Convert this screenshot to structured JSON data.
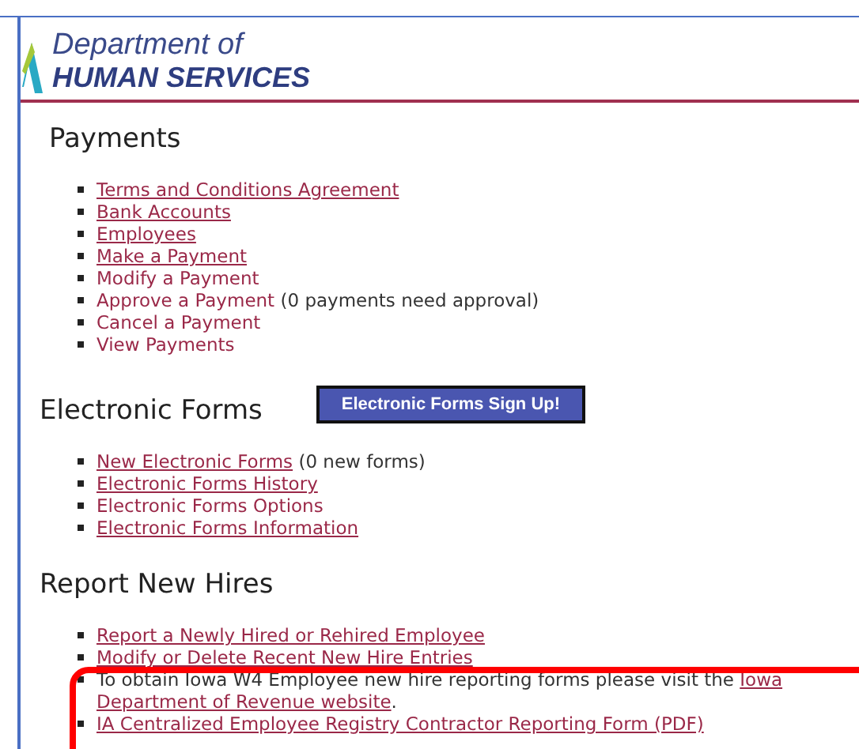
{
  "header": {
    "title_line_1": "Department of",
    "title_line_2": "HUMAN SERVICES"
  },
  "sections": [
    {
      "title": "Payments",
      "items": [
        {
          "kind": "item",
          "label": "Terms and Conditions Agreement",
          "underlined": true
        },
        {
          "kind": "item",
          "label": "Bank Accounts",
          "underlined": true
        },
        {
          "kind": "item",
          "label": "Employees",
          "underlined": true
        },
        {
          "kind": "item",
          "label": "Make a Payment",
          "underlined": true
        },
        {
          "kind": "item",
          "label": "Modify a Payment",
          "underlined": false
        },
        {
          "kind": "item",
          "label": "Approve a Payment",
          "underlined": false,
          "note": "(0 payments need approval)"
        },
        {
          "kind": "item",
          "label": "Cancel a Payment",
          "underlined": false
        },
        {
          "kind": "item",
          "label": "View Payments",
          "underlined": false
        }
      ]
    },
    {
      "title": "Electronic Forms",
      "button": "Electronic Forms Sign Up!",
      "items": [
        {
          "kind": "item",
          "label": "New Electronic Forms",
          "underlined": true,
          "note": "(0 new forms)"
        },
        {
          "kind": "item",
          "label": "Electronic Forms History",
          "underlined": true
        },
        {
          "kind": "item",
          "label": "Electronic Forms Options",
          "underlined": false
        },
        {
          "kind": "item",
          "label": "Electronic Forms Information",
          "underlined": true
        }
      ]
    },
    {
      "title": "Report New Hires",
      "items": [
        {
          "kind": "item",
          "label": "Report a Newly Hired or Rehired Employee",
          "underlined": true
        },
        {
          "kind": "item",
          "label": "Modify or Delete Recent New Hire Entries",
          "underlined": true
        },
        {
          "kind": "sentence",
          "before": "To obtain Iowa W4 Employee new hire reporting forms please visit the",
          "link_parts": [
            "Iowa",
            "Department of Revenue website"
          ],
          "after": "."
        },
        {
          "kind": "item",
          "label": "IA Centralized Employee Registry Contractor Reporting Form (PDF)",
          "underlined": true
        }
      ]
    }
  ],
  "highlight": {
    "shown": true
  }
}
